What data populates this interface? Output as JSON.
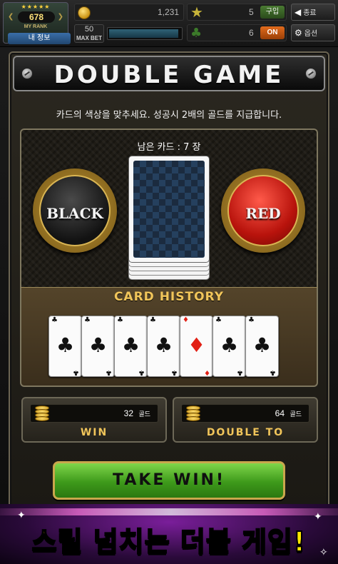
{
  "top_bar": {
    "rank_stars": "★★★★★",
    "rank_value": "678",
    "rank_label": "MY RANK",
    "my_info_button": "내 정보",
    "gold_value": "1,231",
    "max_bet_value": "50",
    "max_bet_label": "MAX BET",
    "max_bet_fill_fraction": 0.97,
    "stars_value": "5",
    "buy_button": "구입",
    "clover_value": "6",
    "on_button": "ON",
    "exit_button": "종료",
    "options_button": "옵션"
  },
  "game": {
    "title": "DOUBLE GAME",
    "description": "카드의 색상을 맞추세요. 성공시 2배의 골드를 지급합니다.",
    "remaining_cards": "남은 카드 : 7 장",
    "black_button": "BLACK",
    "red_button": "RED",
    "history_title": "CARD HISTORY",
    "history_cards": [
      {
        "suit": "♣",
        "color": "black"
      },
      {
        "suit": "♣",
        "color": "black"
      },
      {
        "suit": "♣",
        "color": "black"
      },
      {
        "suit": "♣",
        "color": "black"
      },
      {
        "suit": "♦",
        "color": "red"
      },
      {
        "suit": "♣",
        "color": "black"
      },
      {
        "suit": "♣",
        "color": "black"
      }
    ],
    "win_value": "32",
    "win_unit": "골드",
    "win_label": "WIN",
    "double_value": "64",
    "double_unit": "골드",
    "double_label": "DOUBLE TO",
    "take_win_button": "TAKE WIN!"
  },
  "banner": {
    "text": "스릴 넘치는 더블 게임!"
  },
  "colors": {
    "gold_text": "#f1c55a",
    "take_win_green": "#3e9a1b",
    "red_chip": "#b8130c",
    "banner_text": "#ffe600"
  },
  "icons": [
    "coin-icon",
    "star-icon",
    "clover-icon",
    "exit-icon",
    "gear-icon",
    "bolt-icon"
  ]
}
